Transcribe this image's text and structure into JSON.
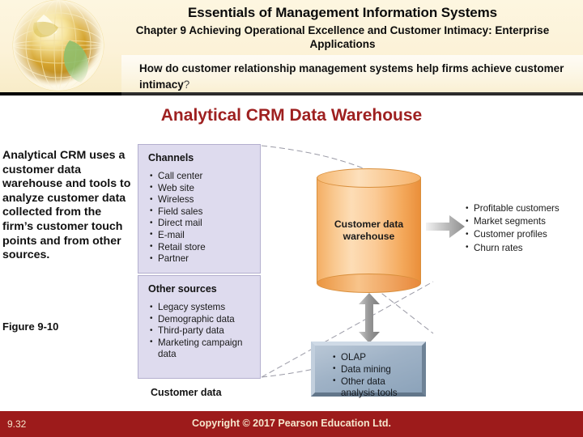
{
  "header": {
    "title": "Essentials of Management Information Systems",
    "subtitle": "Chapter 9 Achieving Operational Excellence and Customer Intimacy: Enterprise Applications",
    "question": "How do customer relationship management systems help firms achieve customer intimacy",
    "question_mark": "?",
    "logo_icon": "globe-icon"
  },
  "slide": {
    "title": "Analytical CRM Data Warehouse",
    "title_color": "#9e2020",
    "description": "Analytical CRM uses a customer data warehouse and tools to analyze customer data collected from the firm’s customer touch points and from other sources.",
    "figure_label": "Figure 9-10"
  },
  "diagram": {
    "channels": {
      "heading": "Channels",
      "items": [
        "Call center",
        "Web site",
        "Wireless",
        "Field sales",
        "Direct mail",
        "E-mail",
        "Retail store",
        "Partner"
      ]
    },
    "other_sources": {
      "heading": "Other sources",
      "items": [
        "Legacy systems",
        "Demographic data",
        "Third-party data",
        "Marketing campaign"
      ],
      "items_continuation": "data"
    },
    "customer_data_caption": "Customer data",
    "warehouse": {
      "label_line1": "Customer data",
      "label_line2": "warehouse",
      "color": "#f4a95c"
    },
    "analysis_tools": {
      "items": [
        "OLAP",
        "Data mining",
        "Other data"
      ],
      "items_continuation": "analysis tools",
      "color": "#9fb2c6"
    },
    "outputs": [
      "Profitable customers",
      "Market segments",
      "Customer profiles",
      "Churn rates"
    ],
    "arrow_right_icon": "arrow-right-icon",
    "arrow_vertical_icon": "double-arrow-vertical-icon"
  },
  "footer": {
    "page_number": "9.32",
    "copyright": "Copyright © 2017 Pearson Education Ltd.",
    "background": "#9d1b1b"
  }
}
